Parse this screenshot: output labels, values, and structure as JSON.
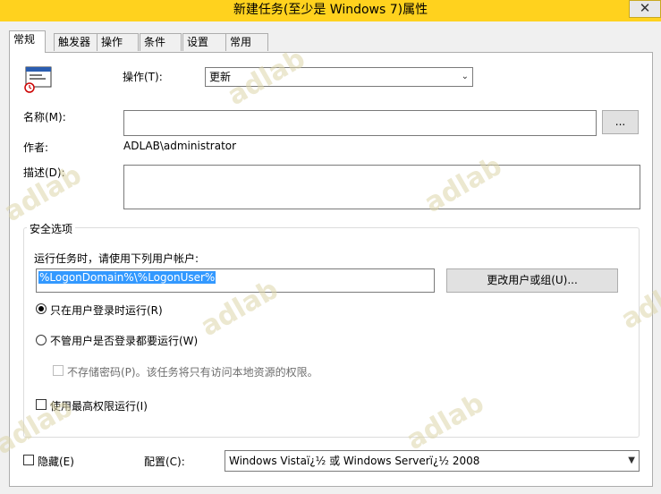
{
  "window": {
    "title": "新建任务(至少是 Windows 7)属性",
    "close_glyph": "✕"
  },
  "tabs": [
    {
      "label": "常规"
    },
    {
      "label": "触发器"
    },
    {
      "label": "操作"
    },
    {
      "label": "条件"
    },
    {
      "label": "设置"
    },
    {
      "label": "常用"
    }
  ],
  "general": {
    "action_label": "操作(T):",
    "action_value": "更新",
    "name_label": "名称(M):",
    "name_value": "",
    "browse_label": "...",
    "author_label": "作者:",
    "author_value": "ADLAB\\administrator",
    "description_label": "描述(D):",
    "description_value": ""
  },
  "security": {
    "title": "安全选项",
    "run_as_label": "运行任务时，请使用下列用户帐户:",
    "user_account": "%LogonDomain%\\%LogonUser%",
    "change_user_button": "更改用户或组(U)...",
    "run_logged_on": "只在用户登录时运行(R)",
    "run_whether": "不管用户是否登录都要运行(W)",
    "no_store_password": "不存储密码(P)。该任务将只有访问本地资源的权限。",
    "run_highest": "使用最高权限运行(I)"
  },
  "footer": {
    "hidden_label": "隐藏(E)",
    "configure_label": "配置(C):",
    "configure_value": "Windows Vistaï¿½ 或 Windows Serverï¿½ 2008"
  },
  "watermark_text": "adlab",
  "icons": [
    "close-icon",
    "task-window-icon",
    "dropdown-arrow-icon"
  ]
}
